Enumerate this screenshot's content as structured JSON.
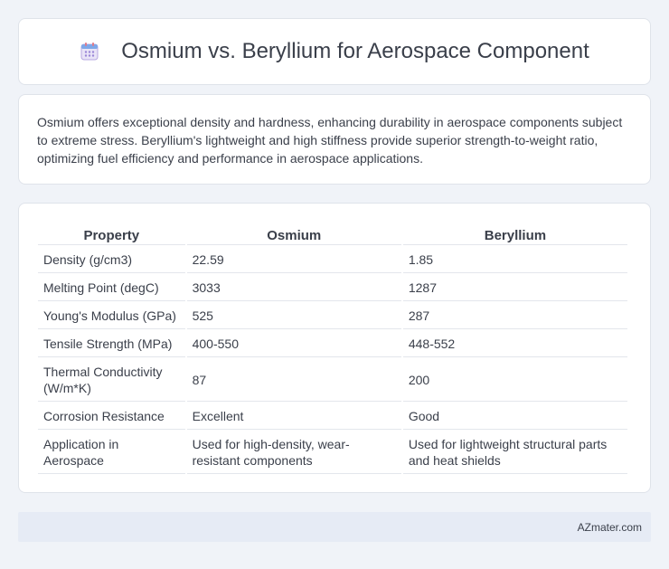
{
  "header": {
    "title": "Osmium vs. Beryllium for Aerospace Component",
    "icon": "calendar-icon"
  },
  "summary": {
    "text": "Osmium offers exceptional density and hardness, enhancing durability in aerospace components subject to extreme stress. Beryllium's lightweight and high stiffness provide superior strength-to-weight ratio, optimizing fuel efficiency and performance in aerospace applications."
  },
  "table": {
    "headers": [
      "Property",
      "Osmium",
      "Beryllium"
    ],
    "rows": [
      [
        "Density (g/cm3)",
        "22.59",
        "1.85"
      ],
      [
        "Melting Point (degC)",
        "3033",
        "1287"
      ],
      [
        "Young's Modulus (GPa)",
        "525",
        "287"
      ],
      [
        "Tensile Strength (MPa)",
        "400-550",
        "448-552"
      ],
      [
        "Thermal Conductivity (W/m*K)",
        "87",
        "200"
      ],
      [
        "Corrosion Resistance",
        "Excellent",
        "Good"
      ],
      [
        "Application in Aerospace",
        "Used for high-density, wear-resistant components",
        "Used for lightweight structural parts and heat shields"
      ]
    ]
  },
  "footer": {
    "text": "AZmater.com"
  },
  "colors": {
    "background": "#f0f3f8",
    "card": "#ffffff",
    "footer": "#e6ebf5",
    "icon_accent": "#8e7cc3"
  }
}
